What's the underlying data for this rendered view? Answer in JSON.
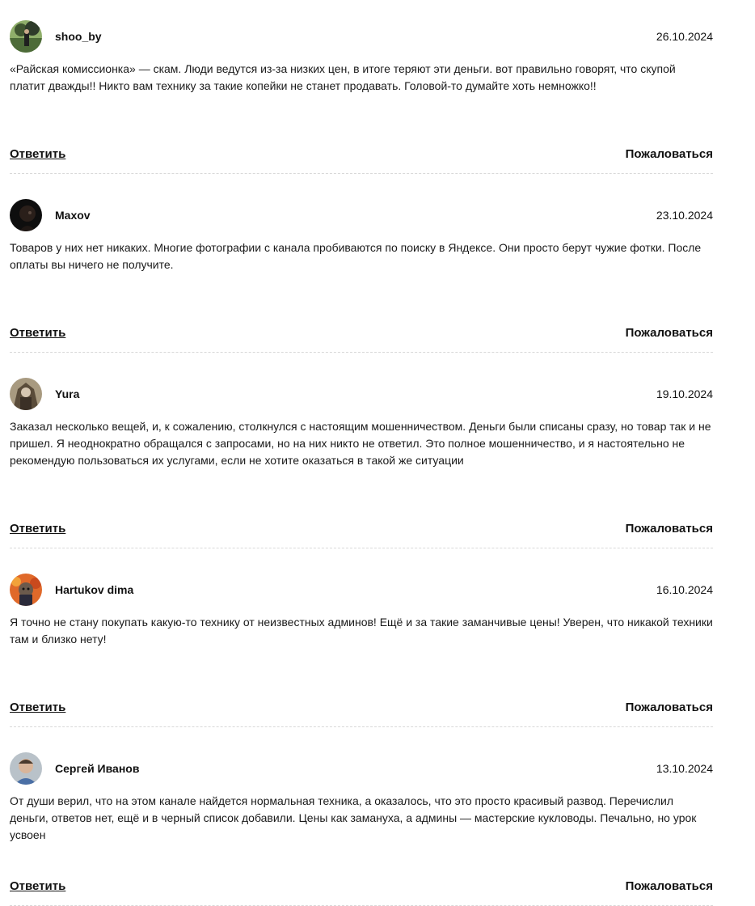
{
  "comments": [
    {
      "author": "shoo_by",
      "date": "26.10.2024",
      "text": "«Райская комиссионка» — скам. Люди ведутся из-за низких цен, в итоге теряют эти деньги. вот правильно говорят, что скупой платит дважды!! Никто вам технику за такие копейки не станет продавать. Головой-то думайте хоть немножко!!",
      "reply_label": "Ответить",
      "report_label": "Пожаловаться",
      "avatar_colors": [
        "#6f8a52",
        "#2e3b2a"
      ]
    },
    {
      "author": "Maxov",
      "date": "23.10.2024",
      "text": "Товаров у них нет никаких. Многие фотографии с канала пробиваются по поиску в Яндексе. Они просто берут чужие фотки. После оплаты вы ничего не получите.",
      "reply_label": "Ответить",
      "report_label": "Пожаловаться",
      "avatar_colors": [
        "#111111",
        "#3a2a22"
      ]
    },
    {
      "author": "Yura",
      "date": "19.10.2024",
      "text": "Заказал несколько вещей, и, к сожалению, столкнулся с настоящим мошенничеством. Деньги были списаны сразу, но товар так и не пришел. Я неоднократно обращался с запросами, но на них никто не ответил. Это полное мошенничество, и я настоятельно не рекомендую пользоваться их услугами, если не хотите оказаться в такой же ситуации",
      "reply_label": "Ответить",
      "report_label": "Пожаловаться",
      "avatar_colors": [
        "#8a7a62",
        "#3b3026"
      ]
    },
    {
      "author": "Hartukov dima",
      "date": "16.10.2024",
      "text": "Я точно не стану покупать какую-то технику от неизвестных админов! Ещё и за такие заманчивые цены! Уверен, что никакой техники там и близко нету!",
      "reply_label": "Ответить",
      "report_label": "Пожаловаться",
      "avatar_colors": [
        "#e0692a",
        "#2a2a3a"
      ]
    },
    {
      "author": "Сергей Иванов",
      "date": "13.10.2024",
      "text": "От души верил, что на этом канале найдется нормальная техника, а оказалось, что это просто красивый развод. Перечислил деньги, ответов нет, ещё и в черный список добавили. Цены как замануха, а админы — мастерские кукловоды. Печально, но урок усвоен",
      "reply_label": "Ответить",
      "report_label": "Пожаловаться",
      "avatar_colors": [
        "#c9b9a8",
        "#4a6fa5"
      ]
    }
  ]
}
